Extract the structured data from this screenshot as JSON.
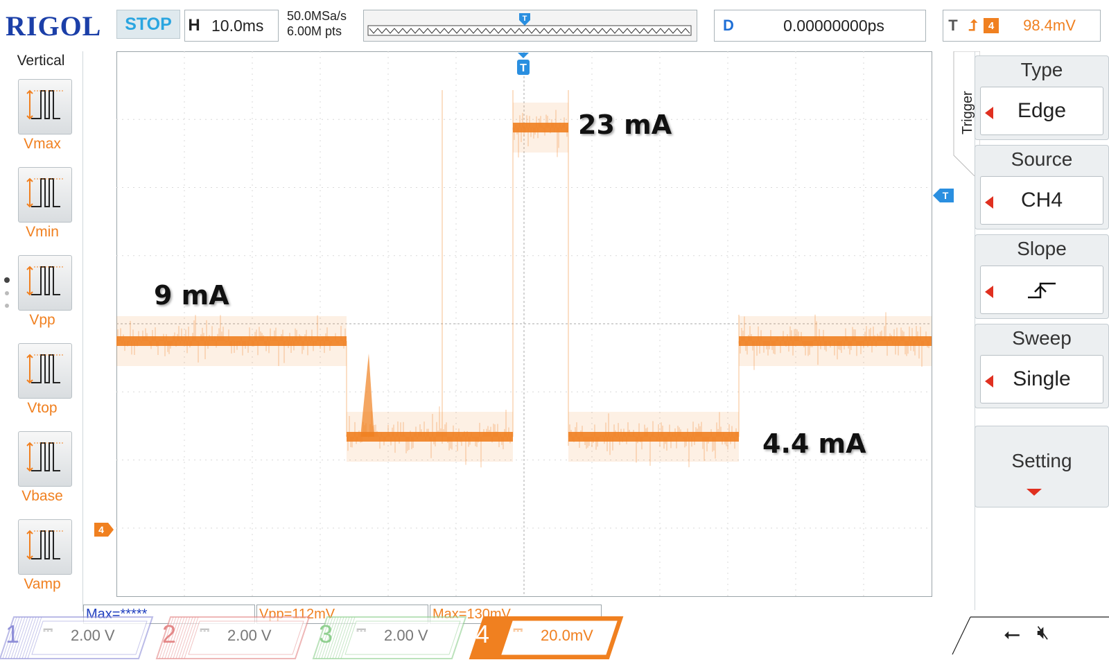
{
  "header": {
    "logo": "RIGOL",
    "run_state": "STOP",
    "horizontal": {
      "label": "H",
      "value": "10.0ms"
    },
    "sample_rate": "50.0MSa/s",
    "memory_depth": "6.00M pts",
    "trigger_marker": "T",
    "delay": {
      "label": "D",
      "value": "0.00000000ps"
    },
    "trigger": {
      "label": "T",
      "edge_icon": "rising-edge-icon",
      "channel": "4",
      "level": "98.4mV"
    }
  },
  "left_panel": {
    "title": "Vertical",
    "measurements": [
      {
        "label": "Vmax",
        "icon": "vmax-icon"
      },
      {
        "label": "Vmin",
        "icon": "vmin-icon"
      },
      {
        "label": "Vpp",
        "icon": "vpp-icon"
      },
      {
        "label": "Vtop",
        "icon": "vtop-icon"
      },
      {
        "label": "Vbase",
        "icon": "vbase-icon"
      },
      {
        "label": "Vamp",
        "icon": "vamp-icon"
      }
    ]
  },
  "screen": {
    "channel_marker": "4",
    "trigger_marker_top": "T",
    "trigger_marker_right": "T",
    "annotations": [
      "9 mA",
      "23 mA",
      "4.4 mA"
    ],
    "trace_color": "#f08020"
  },
  "right_menu": {
    "tab": "Trigger",
    "items": [
      {
        "title": "Type",
        "value": "Edge"
      },
      {
        "title": "Source",
        "value": "CH4"
      },
      {
        "title": "Slope",
        "value": "",
        "icon": "rising-slope-icon"
      },
      {
        "title": "Sweep",
        "value": "Single"
      },
      {
        "title": "Setting",
        "value": "",
        "icon": "down-arrow-icon"
      }
    ]
  },
  "measurement_bar": [
    {
      "text": "Max=*****",
      "color": "#1f3fbf"
    },
    {
      "text": "Vpp=112mV",
      "color": "#f08020"
    },
    {
      "text": "Max=130mV",
      "color": "#f08020"
    }
  ],
  "channels": [
    {
      "num": "1",
      "coupling": "⎓",
      "scale": "2.00 V",
      "color": "#8f8fd8"
    },
    {
      "num": "2",
      "coupling": "⎓",
      "scale": "2.00 V",
      "color": "#e48888"
    },
    {
      "num": "3",
      "coupling": "⎓",
      "scale": "2.00 V",
      "color": "#8fcf8f"
    },
    {
      "num": "4",
      "coupling": "⎓",
      "scale": "20.0mV",
      "color": "#f08020"
    }
  ],
  "status_icons": [
    "usb-icon",
    "mute-speaker-icon"
  ]
}
